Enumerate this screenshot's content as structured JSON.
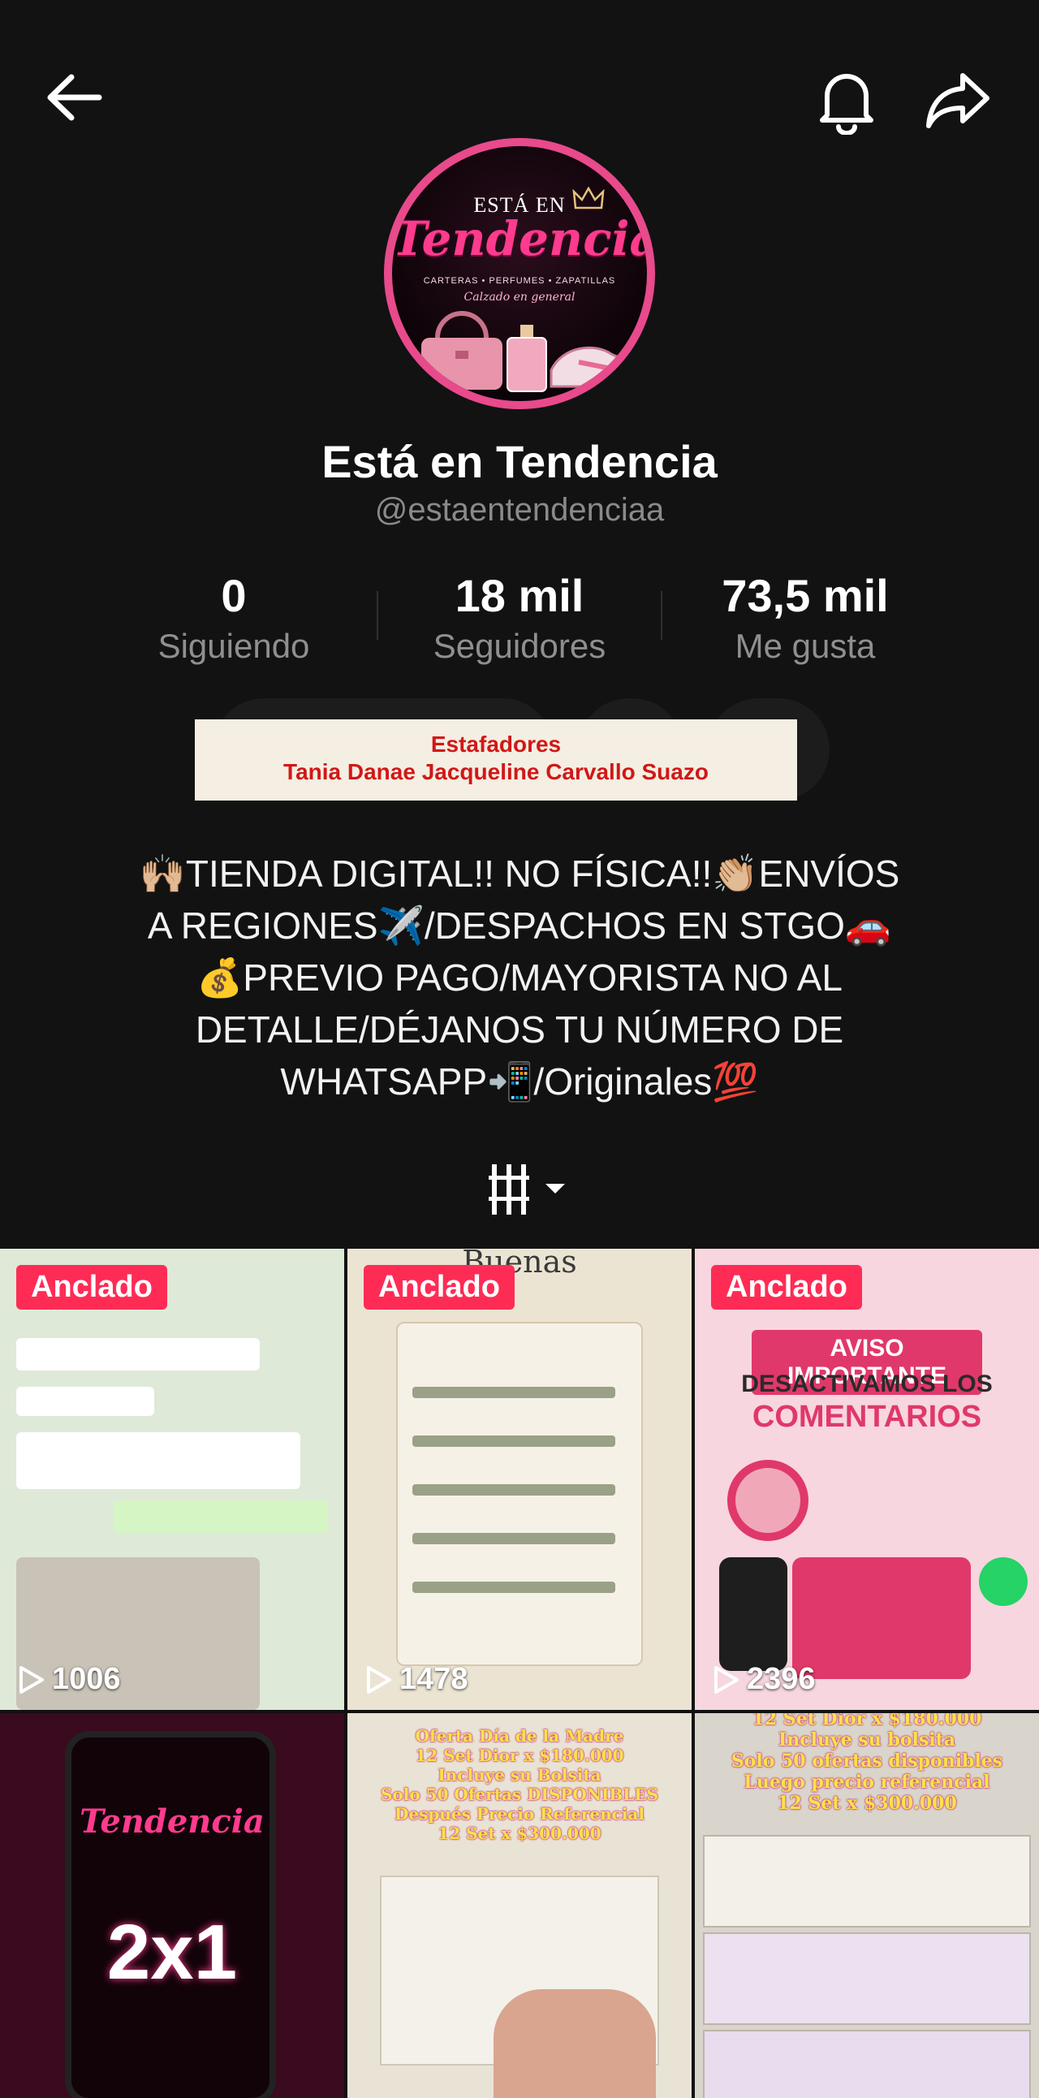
{
  "profile": {
    "display_name": "Está en Tendencia",
    "handle": "@estaentendenciaa",
    "avatar": {
      "line1": "ESTÁ EN",
      "line2": "Tendencia",
      "line3": "CARTERAS • PERFUMES • ZAPATILLAS",
      "line4": "Calzado en general"
    }
  },
  "stats": [
    {
      "value": "0",
      "label": "Siguiendo"
    },
    {
      "value": "18 mil",
      "label": "Seguidores"
    },
    {
      "value": "73,5 mil",
      "label": "Me gusta"
    }
  ],
  "scam_banner": {
    "line1": "Estafadores",
    "line2": "Tania Danae Jacqueline Carvallo Suazo"
  },
  "bio": [
    "🙌🏼TIENDA DIGITAL!! NO FÍSICA!!👏🏼ENVÍOS",
    "A REGIONES✈️/DESPACHOS EN STGO🚗",
    "💰PREVIO PAGO/MAYORISTA NO AL",
    "DETALLE/DÉJANOS TU NÚMERO DE",
    "WHATSAPP📲/Originales💯"
  ],
  "videos": [
    {
      "pinned_label": "Anclado",
      "views": "1006",
      "thumb": "chat-screenshot"
    },
    {
      "pinned_label": "Anclado",
      "views": "1478",
      "thumb": "info-flyer",
      "caption_top": "Buenas"
    },
    {
      "pinned_label": "Anclado",
      "views": "2396",
      "thumb": "notice-flyer",
      "caption1": "AVISO IMPORTANTE",
      "caption2": "DESACTIVAMOS LOS",
      "caption3": "COMENTARIOS"
    },
    {
      "thumb": "promo-phone",
      "caption1": "2x1"
    },
    {
      "thumb": "unboxing",
      "caption1": "Oferta Día de la Madre",
      "caption2": "12 Set Dior x $180.000",
      "caption3": "Incluye su Bolsita",
      "caption4": "Solo 50 Ofertas DISPONIBLES",
      "caption5": "Después Precio Referencial",
      "caption6": "12 Set x $300.000"
    },
    {
      "thumb": "boxes",
      "caption1": "12 Set Dior x $180.000",
      "caption2": "Incluye su bolsita",
      "caption3": "Solo 50 ofertas disponibles",
      "caption4": "Luego precio referencial",
      "caption5": "12 Set x $300.000"
    }
  ]
}
